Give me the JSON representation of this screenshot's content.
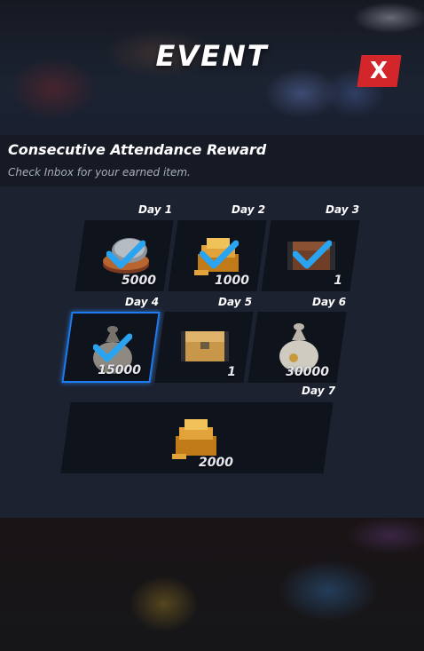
{
  "header": {
    "title": "EVENT",
    "close_label": "X"
  },
  "panel": {
    "title": "Consecutive Attendance Reward",
    "subtitle": "Check Inbox for your earned item."
  },
  "rewards": [
    {
      "day": "Day 1",
      "quantity": "5000",
      "item_icon": "coins-icon",
      "claimed": true
    },
    {
      "day": "Day 2",
      "quantity": "1000",
      "item_icon": "gold-bars-icon",
      "claimed": true
    },
    {
      "day": "Day 3",
      "quantity": "1",
      "item_icon": "chest-icon",
      "claimed": true
    },
    {
      "day": "Day 4",
      "quantity": "15000",
      "item_icon": "money-bag-icon",
      "claimed": true,
      "selected": true
    },
    {
      "day": "Day 5",
      "quantity": "1",
      "item_icon": "gold-box-icon",
      "claimed": false
    },
    {
      "day": "Day 6",
      "quantity": "30000",
      "item_icon": "money-bag-icon",
      "claimed": false
    },
    {
      "day": "Day 7",
      "quantity": "2000",
      "item_icon": "gold-bars-icon",
      "claimed": false
    }
  ],
  "colors": {
    "close_button": "#d2262a",
    "check": "#2aa3f0",
    "selected_border": "#1f7cf0"
  }
}
